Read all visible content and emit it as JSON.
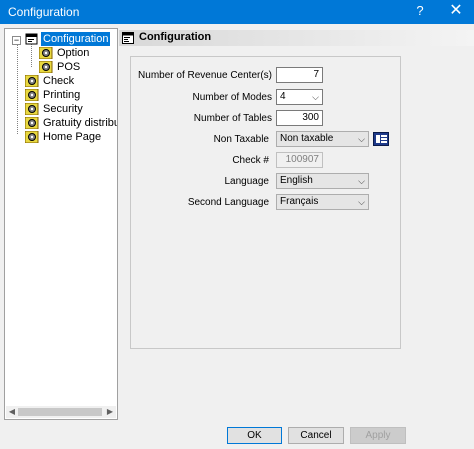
{
  "window": {
    "title": "Configuration",
    "help_glyph": "?",
    "close_glyph": "✕"
  },
  "tree": {
    "expander_glyph": "−",
    "items": [
      {
        "label": "Configuration",
        "level": 0,
        "selected": true
      },
      {
        "label": "Option",
        "level": 1
      },
      {
        "label": "POS",
        "level": 1
      },
      {
        "label": "Check",
        "level": 0
      },
      {
        "label": "Printing",
        "level": 0
      },
      {
        "label": "Security",
        "level": 0
      },
      {
        "label": "Gratuity distribution",
        "level": 0
      },
      {
        "label": "Home Page",
        "level": 0
      }
    ]
  },
  "panel": {
    "title": "Configuration"
  },
  "form": {
    "revenue_centers": {
      "label": "Number of Revenue Center(s)",
      "value": "7"
    },
    "modes": {
      "label": "Number of Modes",
      "value": "4"
    },
    "tables": {
      "label": "Number of Tables",
      "value": "300"
    },
    "non_taxable": {
      "label": "Non Taxable",
      "value": "Non taxable"
    },
    "check_no": {
      "label": "Check #",
      "value": "100907"
    },
    "language": {
      "label": "Language",
      "value": "English"
    },
    "second_language": {
      "label": "Second Language",
      "value": "Français"
    }
  },
  "buttons": {
    "ok": "OK",
    "cancel": "Cancel",
    "apply": "Apply"
  },
  "colors": {
    "titlebar": "#0078d7",
    "selection": "#0078d7",
    "grid_button": "#1e3a8a"
  }
}
